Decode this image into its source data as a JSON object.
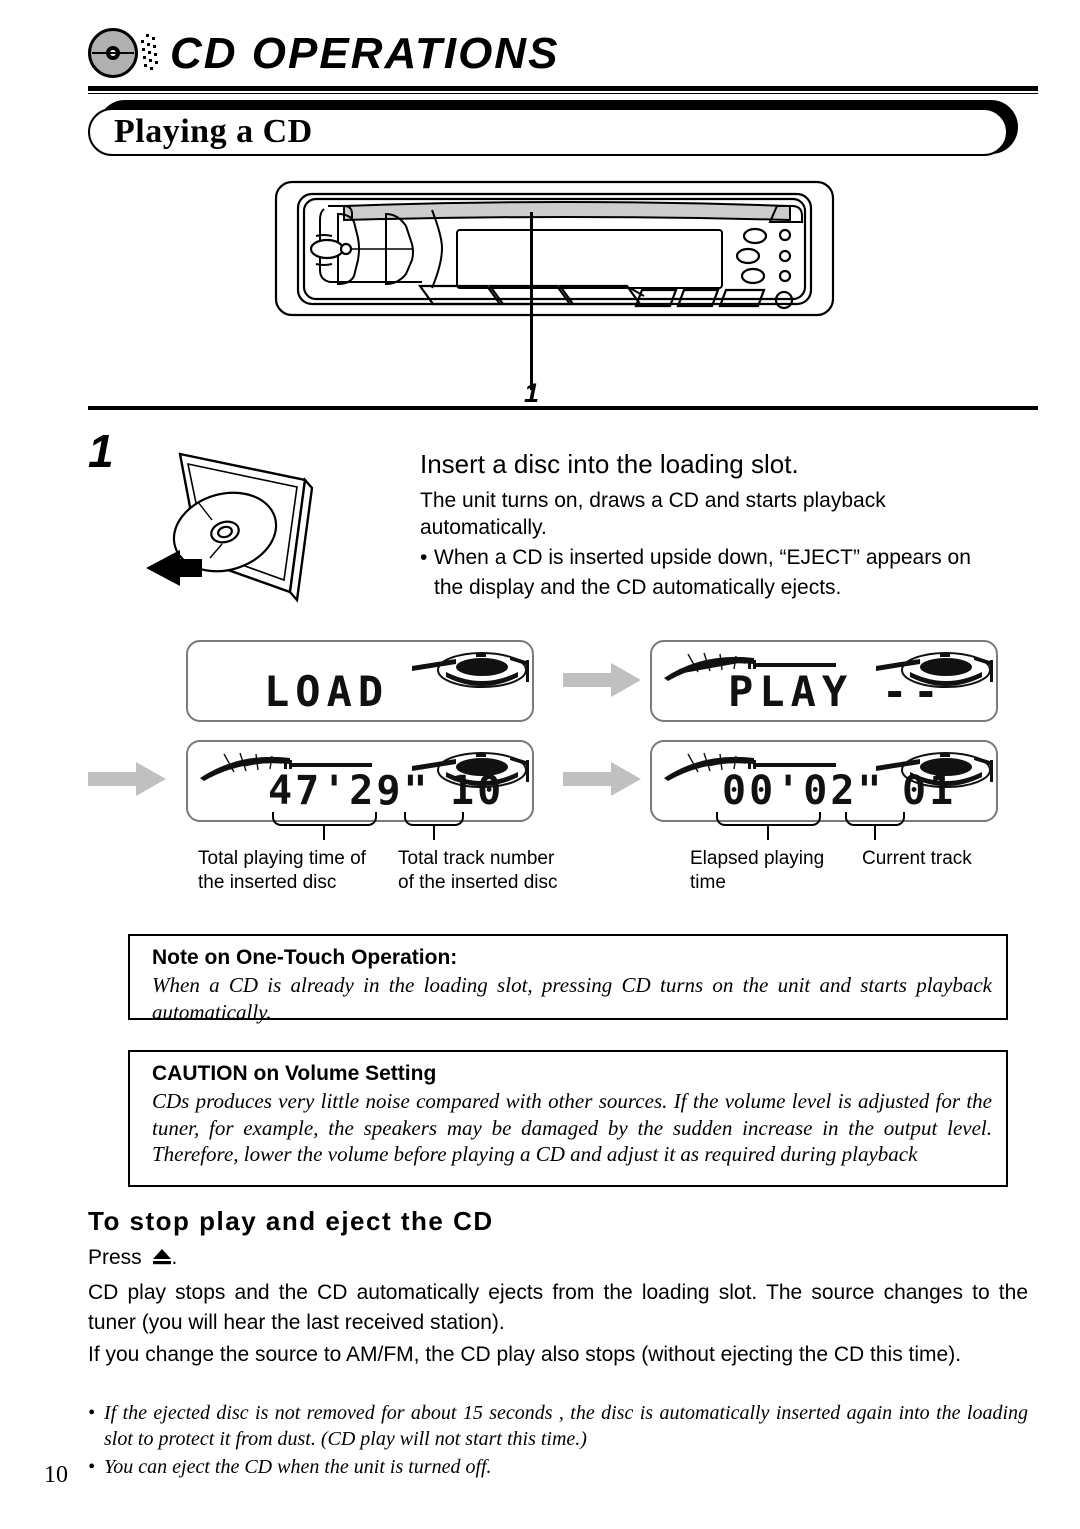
{
  "header": {
    "icon": "cd-disc-icon",
    "title": "CD OPERATIONS"
  },
  "section": {
    "label": "Playing a CD"
  },
  "illustration": {
    "name": "car-stereo-front-panel",
    "callout_label": "1",
    "callout_target": "loading slot"
  },
  "step": {
    "number": "1",
    "art": "disc-inserted-into-slot-illustration",
    "heading": "Insert a disc into the loading slot.",
    "body_line_1": "The unit turns on, draws a CD and starts playback",
    "body_line_2": "automatically.",
    "bullet_dot": "•",
    "bullet_line_1": "When a CD is inserted upside down, “EJECT” appears on",
    "bullet_line_2": "the display and the CD automatically ejects."
  },
  "displays": [
    {
      "id": "display-load",
      "text": "LOAD",
      "icons": [
        "cd-disc-indicator"
      ]
    },
    {
      "id": "display-play",
      "text": "PLAY",
      "suffix": "--",
      "icons": [
        "sound-fan-indicator",
        "cd-disc-indicator"
      ]
    },
    {
      "id": "display-total-time",
      "time": "47'29\"",
      "track": "10",
      "icons": [
        "sound-fan-indicator",
        "cd-disc-indicator"
      ]
    },
    {
      "id": "display-elapsed-time",
      "time": "00'02\"",
      "track": "01",
      "icons": [
        "sound-fan-indicator",
        "cd-disc-indicator"
      ]
    }
  ],
  "arrows": {
    "glyph": "arrow-right",
    "color": "#c0c0c0"
  },
  "captions": {
    "total_time": "Total playing time of\nthe inserted disc",
    "total_time_l1": "Total playing time of",
    "total_time_l2": "the inserted disc",
    "total_track_l1": "Total track number",
    "total_track_l2": "of the inserted disc",
    "elapsed_l1": "Elapsed playing",
    "elapsed_l2": "time",
    "current_track_l1": "Current track"
  },
  "note_box": {
    "title": "Note on One-Touch Operation:",
    "body": "When a CD is already in the loading slot, pressing CD turns on the unit and starts playback automatically."
  },
  "caution_box": {
    "title": "CAUTION on Volume Setting",
    "body": "CDs produces very little noise compared with other sources. If the volume level is adjusted for the tuner, for example, the speakers may be damaged by the sudden increase in the output level. Therefore, lower the volume before playing a CD and adjust it as required during playback"
  },
  "bottom": {
    "heading": "To stop play and eject the CD",
    "press_label": "Press",
    "press_icon": "eject-icon",
    "press_suffix": ".",
    "paragraph_1": "CD play stops and the CD automatically ejects from the loading slot. The source changes to the tuner (you will hear the last received station).",
    "paragraph_2": "If you change the source to AM/FM, the CD play also stops (without ejecting the CD this time).",
    "bullet_dot": "•",
    "bullet_1": "If the ejected disc is not removed for about 15 seconds , the disc is automatically inserted again into the loading slot to protect it from dust. (CD play will not start this time.)",
    "bullet_2": "You can eject the CD when the unit is turned off."
  },
  "page_number": "10"
}
